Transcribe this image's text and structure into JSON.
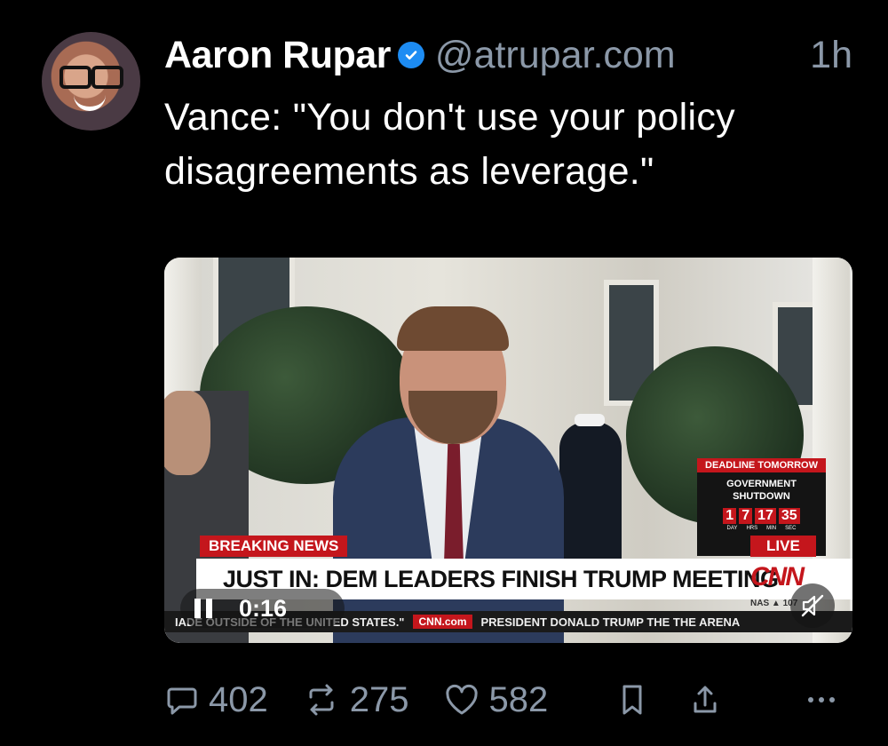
{
  "post": {
    "author_name": "Aaron Rupar",
    "handle": "@atrupar.com",
    "time": "1h",
    "text": "Vance: \"You don't use your policy disagreements as leverage.\""
  },
  "video": {
    "time": "0:16",
    "overlay": {
      "deadline_top": "DEADLINE TOMORROW",
      "deadline_line1": "GOVERNMENT",
      "deadline_line2": "SHUTDOWN",
      "countdown": [
        "1",
        "7",
        "17",
        "35"
      ],
      "countdown_units": [
        "DAY",
        "HRS",
        "MIN",
        "SEC"
      ],
      "breaking": "BREAKING NEWS",
      "live": "LIVE",
      "headline": "JUST IN: DEM LEADERS FINISH TRUMP MEETING",
      "logo": "CNN",
      "nas": "NAS ▲ 107",
      "ticker_left": "IADE OUTSIDE OF THE UNITED STATES.\"",
      "ticker_site": "CNN.com",
      "ticker_right": "PRESIDENT DONALD TRUMP THE THE ARENA"
    }
  },
  "actions": {
    "replies": "402",
    "reposts": "275",
    "likes": "582"
  },
  "colors": {
    "background": "#000000",
    "muted": "#8b98a8",
    "verified": "#1d8cf3",
    "cnn_red": "#c4161c"
  }
}
